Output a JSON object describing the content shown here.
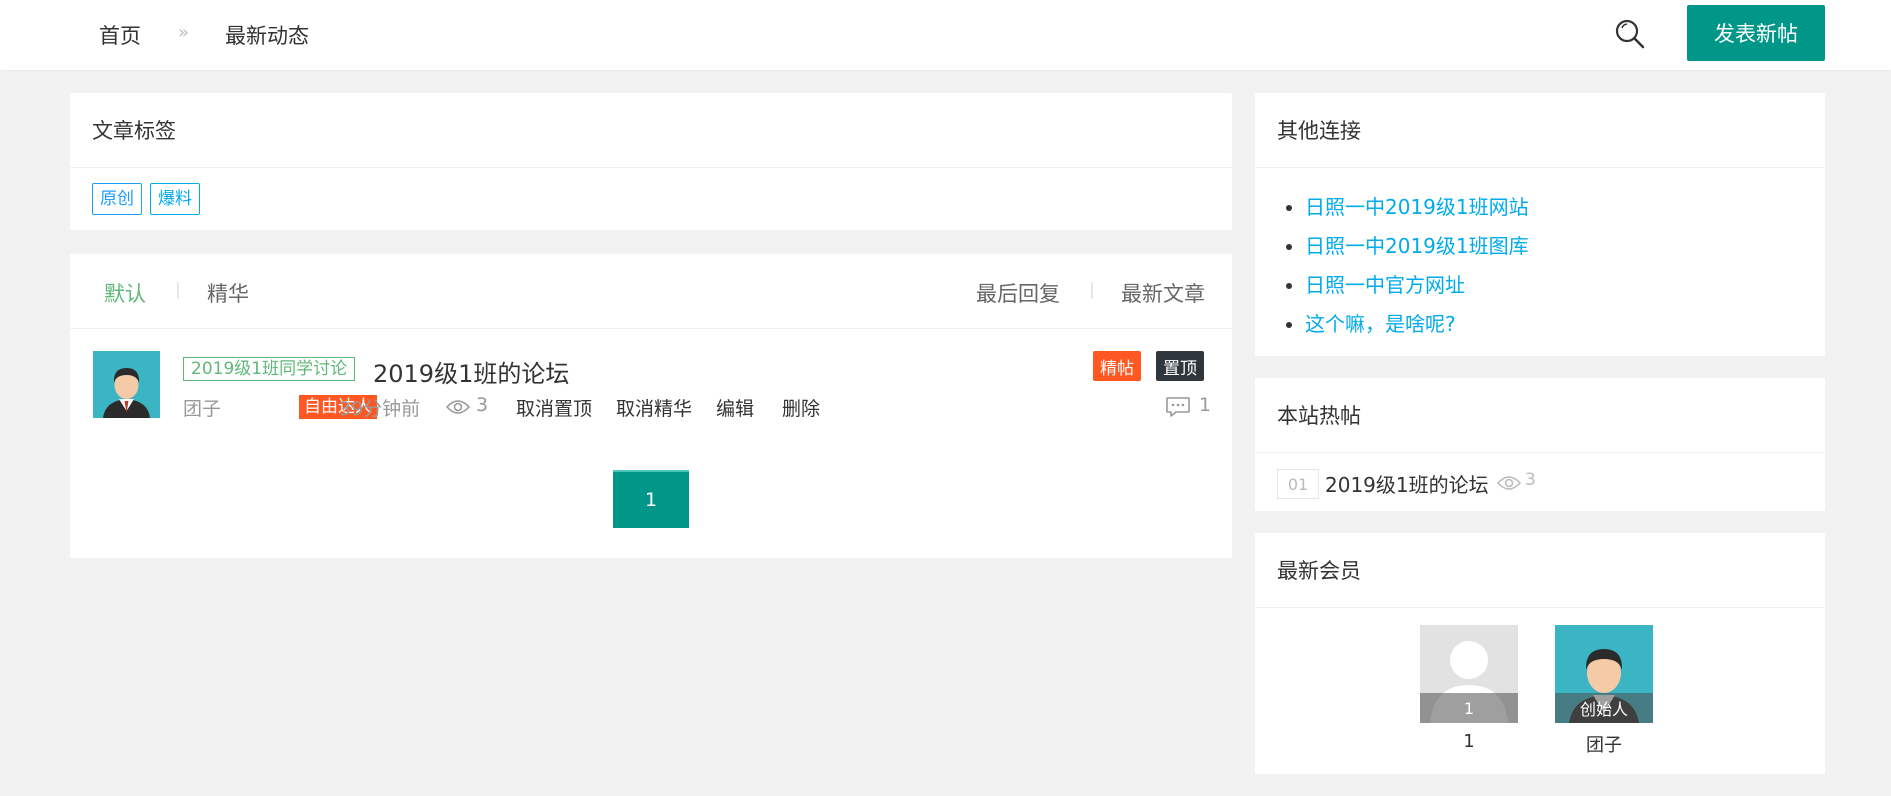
{
  "header": {
    "breadcrumb_home": "首页",
    "breadcrumb_sep": "»",
    "breadcrumb_current": "最新动态",
    "post_button": "发表新帖",
    "icons": {
      "search": "search-icon"
    }
  },
  "tags_card": {
    "title": "文章标签",
    "tags": [
      "原创",
      "爆料"
    ]
  },
  "list_card": {
    "filters": [
      "默认",
      "精华"
    ],
    "sorts": [
      "最后回复",
      "最新文章"
    ],
    "post": {
      "category": "2019级1班同学讨论",
      "title": "2019级1班的论坛",
      "badge_featured": "精帖",
      "badge_pinned": "置顶",
      "author": "团子",
      "author_badge": "自由达人",
      "time": "39分钟前",
      "views": "3",
      "actions": [
        "取消置顶",
        "取消精华",
        "编辑",
        "删除"
      ],
      "comments": "1"
    },
    "page": "1"
  },
  "links_card": {
    "title": "其他连接",
    "links": [
      "日照一中2019级1班网站",
      "日照一中2019级1班图库",
      "日照一中官方网址",
      "这个嘛，是啥呢?"
    ]
  },
  "hot_card": {
    "title": "本站热帖",
    "items": [
      {
        "rank": "01",
        "title": "2019级1班的论坛",
        "views": "3"
      }
    ]
  },
  "members_card": {
    "title": "最新会员",
    "members": [
      {
        "label": "1",
        "name": "1"
      },
      {
        "label": "创始人",
        "name": "团子"
      }
    ]
  },
  "colors": {
    "primary": "#009688",
    "accent": "#ff5722",
    "link": "#01aaed",
    "active_filter": "#5fb878"
  }
}
